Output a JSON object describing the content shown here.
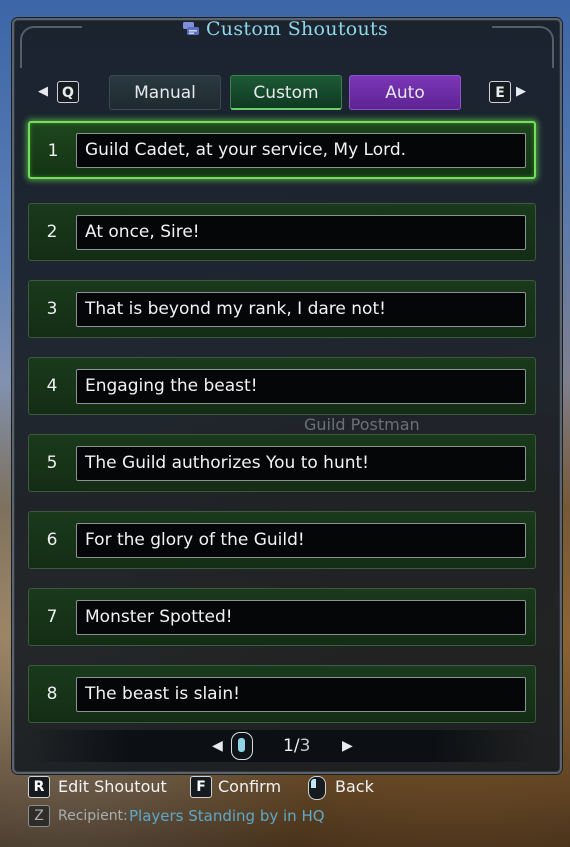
{
  "header": {
    "title": "Custom Shoutouts",
    "icon": "speech-bubble-icon"
  },
  "tabs": {
    "left_key": "Q",
    "right_key": "E",
    "items": [
      {
        "label": "Manual",
        "color": "#1e2a30"
      },
      {
        "label": "Custom",
        "color": "#1d5a36",
        "active": true
      },
      {
        "label": "Auto",
        "color": "#6a2aa3"
      }
    ]
  },
  "shoutouts": [
    {
      "num": "1",
      "text": "Guild Cadet, at your service, My Lord.",
      "selected": true
    },
    {
      "num": "2",
      "text": "At once, Sire!"
    },
    {
      "num": "3",
      "text": "That is beyond my rank, I dare not!"
    },
    {
      "num": "4",
      "text": "Engaging the beast!"
    },
    {
      "num": "5",
      "text": "The Guild authorizes You to hunt!"
    },
    {
      "num": "6",
      "text": "For the glory of the Guild!"
    },
    {
      "num": "7",
      "text": "Monster Spotted!"
    },
    {
      "num": "8",
      "text": "The beast is slain!"
    }
  ],
  "background_label": "Guild Postman",
  "pager": {
    "current": "1",
    "separator": "/",
    "total": "3"
  },
  "controls": [
    {
      "key": "R",
      "label": "Edit Shoutout"
    },
    {
      "key": "F",
      "label": "Confirm"
    },
    {
      "key": "mouse-right-icon",
      "label": "Back"
    }
  ],
  "recipient": {
    "key": "Z",
    "label": "Recipient:",
    "value": "Players Standing by in HQ"
  },
  "colors": {
    "accent_title": "#8fd6e8",
    "selection_glow": "#72e05a",
    "auto_tab": "#7a36b8"
  }
}
